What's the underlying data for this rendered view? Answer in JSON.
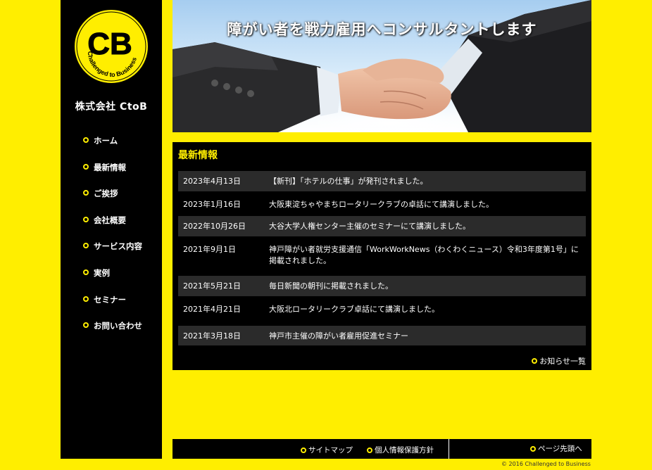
{
  "company": {
    "name": "株式会社 CtoB",
    "logo_letters": "CB",
    "logo_tagline": "Challenged to Business"
  },
  "nav": {
    "items": [
      {
        "label": "ホーム"
      },
      {
        "label": "最新情報"
      },
      {
        "label": "ご挨拶"
      },
      {
        "label": "会社概要"
      },
      {
        "label": "サービス内容"
      },
      {
        "label": "実例"
      },
      {
        "label": "セミナー"
      },
      {
        "label": "お問い合わせ"
      }
    ]
  },
  "hero": {
    "title": "障がい者を戦力雇用へコンサルタントします"
  },
  "news": {
    "heading": "最新情報",
    "items": [
      {
        "date": "2023年4月13日",
        "text": "【新刊】「ホテルの仕事」が発刊されました。"
      },
      {
        "date": "2023年1月16日",
        "text": "大阪東淀ちゃやまちロータリークラブの卓話にて講演しました。"
      },
      {
        "date": "2022年10月26日",
        "text": "大谷大学人権センター主催のセミナーにて講演しました。"
      },
      {
        "date": "2021年9月1日",
        "text": "神戸障がい者就労支援通信「WorkWorkNews（わくわくニュース）令和3年度第1号」に掲載されました。"
      },
      {
        "date": "2021年5月21日",
        "text": "毎日新聞の朝刊に掲載されました。"
      },
      {
        "date": "2021年4月21日",
        "text": "大阪北ロータリークラブ卓話にて講演しました。"
      },
      {
        "date": "2021年3月18日",
        "text": "神戸市主催の障がい者雇用促進セミナー"
      }
    ],
    "more_label": "お知らせ一覧"
  },
  "footer": {
    "sitemap": "サイトマップ",
    "privacy": "個人情報保護方針",
    "page_top": "ページ先頭へ",
    "copyright": "© 2016 Challenged to Business"
  },
  "colors": {
    "brand_yellow": "#ffee00",
    "panel_black": "#000000",
    "row_alt": "#2b2b2b"
  }
}
